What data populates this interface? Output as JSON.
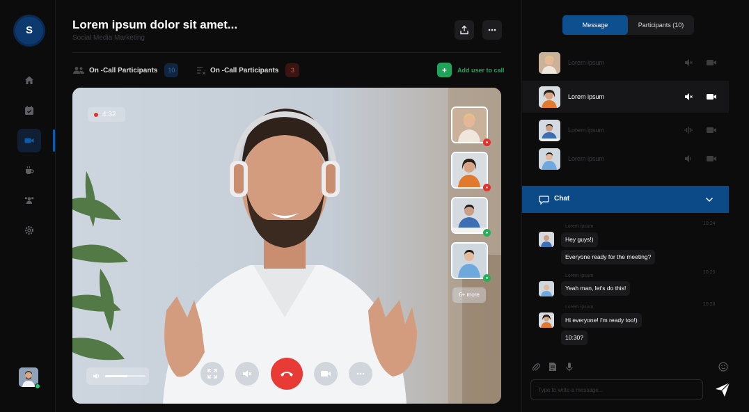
{
  "app": {
    "logo_letter": "S",
    "accent": "#0d4f8f"
  },
  "sidebar": {
    "items": [
      {
        "name": "home",
        "icon": "home-icon",
        "active": false
      },
      {
        "name": "calendar",
        "icon": "calendar-icon",
        "active": false
      },
      {
        "name": "video",
        "icon": "video-camera-icon",
        "active": true
      },
      {
        "name": "coffee",
        "icon": "coffee-icon",
        "active": false
      },
      {
        "name": "users",
        "icon": "users-icon",
        "active": false
      },
      {
        "name": "settings",
        "icon": "gear-icon",
        "active": false
      }
    ]
  },
  "header": {
    "title": "Lorem ipsum dolor sit amet...",
    "subtitle": "Social Media Marketing"
  },
  "participants_bar": {
    "on_call_label": "On -Call Participants",
    "on_call_count": "10",
    "waiting_label": "On -Call Participants",
    "waiting_count": "3",
    "add_user_label": "Add user to call",
    "add_symbol": "+"
  },
  "video": {
    "recording_time": "4:32",
    "more_label": "6+ more",
    "volume_level": 0.55
  },
  "right_panel": {
    "tabs": [
      {
        "label": "Message",
        "active": true
      },
      {
        "label": "Participants (10)",
        "active": false
      }
    ],
    "participants": [
      {
        "name": "Lorem ipsum",
        "selected": false
      },
      {
        "name": "Lorem ipsum",
        "selected": true
      },
      {
        "name": "Lorem ipsum",
        "selected": false
      },
      {
        "name": "Lorem ipsum",
        "selected": false
      }
    ],
    "chat_title": "Chat",
    "messages": [
      {
        "author": "Lorem ipsum",
        "time": "10:24",
        "bubbles": [
          "Hey guys!)",
          "Everyone ready for the meeting?"
        ]
      },
      {
        "author": "Lorem ipsum",
        "time": "10:25",
        "bubbles": [
          "Yeah man, let's do this!"
        ]
      },
      {
        "author": "Lorem ipsum",
        "time": "10:26",
        "bubbles": [
          "Hi everyone! i'm ready too!)",
          "10:30?"
        ]
      }
    ],
    "input_placeholder": "Type to write a message..."
  }
}
